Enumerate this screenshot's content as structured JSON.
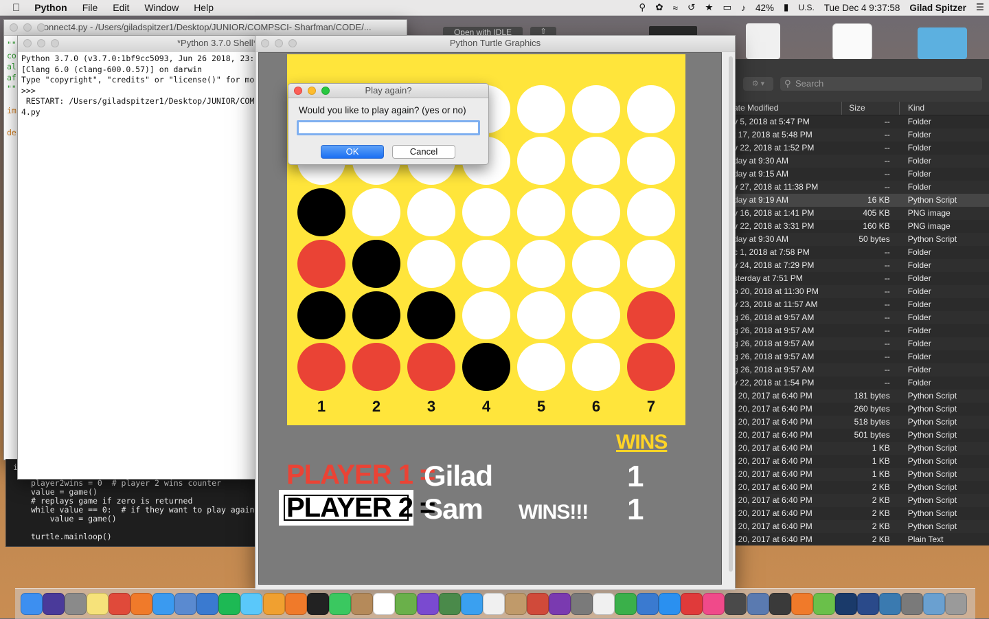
{
  "menubar": {
    "app": "Python",
    "items": [
      "File",
      "Edit",
      "Window",
      "Help"
    ],
    "battery": "42%",
    "input_source": "U.S.",
    "clock": "Tue Dec 4  9:37:58",
    "user": "Gilad  Spitzer"
  },
  "editor": {
    "title": "connect4.py - /Users/giladspitzer1/Desktop/JUNIOR/COMPSCI- Sharfman/CODE/...",
    "open_with_idle": "Open with IDLE",
    "lines": [
      {
        "text": "player2wins = 0  # player 2 wins counter",
        "color": "#e8e8e8"
      },
      {
        "text": "value = game()",
        "color": "#e8e8e8"
      },
      {
        "text": "# replays game if zero is returned",
        "color": "#e8e8e8"
      },
      {
        "text": "while value == 0:  # if they want to play again,",
        "color": "#e8e8e8"
      },
      {
        "text": "    value = game()",
        "color": "#e8e8e8"
      },
      {
        "text": "",
        "color": "#e8e8e8"
      },
      {
        "text": "turtle.mainloop()",
        "color": "#e8e8e8"
      }
    ]
  },
  "shell": {
    "title": "*Python 3.7.0 Shell*",
    "lines": [
      "Python 3.7.0 (v3.7.0:1bf9cc5093, Jun 26 2018, 23:",
      "[Clang 6.0 (clang-600.0.57)] on darwin",
      "Type \"copyright\", \"credits\" or \"license()\" for mo",
      ">>>",
      " RESTART: /Users/giladspitzer1/Desktop/JUNIOR/COM",
      "4.py"
    ]
  },
  "turtle_window": {
    "title": "Python Turtle Graphics"
  },
  "board": {
    "cells": [
      [
        "white",
        "white",
        "white",
        "white",
        "white",
        "white",
        "white"
      ],
      [
        "white",
        "white",
        "white",
        "white",
        "white",
        "white",
        "white"
      ],
      [
        "black",
        "white",
        "white",
        "white",
        "white",
        "white",
        "white"
      ],
      [
        "red",
        "black",
        "white",
        "white",
        "white",
        "white",
        "white"
      ],
      [
        "black",
        "black",
        "black",
        "white",
        "white",
        "white",
        "red"
      ],
      [
        "red",
        "red",
        "red",
        "black",
        "white",
        "white",
        "red"
      ]
    ],
    "column_numbers": [
      "1",
      "2",
      "3",
      "4",
      "5",
      "6",
      "7"
    ],
    "colors": {
      "board": "#ffe53b",
      "white": "#ffffff",
      "black": "#000000",
      "red": "#ea4335"
    }
  },
  "scoreboard": {
    "wins_header": "WINS",
    "player1_label": "PLAYER 1 =",
    "player1_name": "Gilad",
    "player1_wins": "1",
    "player2_label": "PLAYER 2 =",
    "player2_name": "Sam",
    "player2_wins": "1",
    "wins_banner": "WINS!!!",
    "colors": {
      "player1": "#ea4335",
      "wins_header": "#ffd426",
      "text": "#ffffff"
    }
  },
  "dialog": {
    "title": "Play again?",
    "prompt": "Would you like to play again? (yes or no)",
    "input_value": "",
    "ok_label": "OK",
    "cancel_label": "Cancel"
  },
  "finder": {
    "search_placeholder": "Search",
    "columns": {
      "date": "ate Modified",
      "size": "Size",
      "kind": "Kind"
    },
    "rows": [
      {
        "date": "v 5, 2018 at 5:47 PM",
        "size": "--",
        "kind": "Folder"
      },
      {
        "date": "t 17, 2018 at 5:48 PM",
        "size": "--",
        "kind": "Folder"
      },
      {
        "date": "v 22, 2018 at 1:52 PM",
        "size": "--",
        "kind": "Folder"
      },
      {
        "date": "day at 9:30 AM",
        "size": "--",
        "kind": "Folder"
      },
      {
        "date": "day at 9:15 AM",
        "size": "--",
        "kind": "Folder"
      },
      {
        "date": "v 27, 2018 at 11:38 PM",
        "size": "--",
        "kind": "Folder"
      },
      {
        "date": "day at 9:19 AM",
        "size": "16 KB",
        "kind": "Python Script",
        "selected": true
      },
      {
        "date": "v 16, 2018 at 1:41 PM",
        "size": "405 KB",
        "kind": "PNG image"
      },
      {
        "date": "v 22, 2018 at 3:31 PM",
        "size": "160 KB",
        "kind": "PNG image"
      },
      {
        "date": "day at 9:30 AM",
        "size": "50 bytes",
        "kind": "Python Script"
      },
      {
        "date": "c 1, 2018 at 7:58 PM",
        "size": "--",
        "kind": "Folder"
      },
      {
        "date": "v 24, 2018 at 7:29 PM",
        "size": "--",
        "kind": "Folder"
      },
      {
        "date": "sterday at 7:51 PM",
        "size": "--",
        "kind": "Folder"
      },
      {
        "date": "p 20, 2018 at 11:30 PM",
        "size": "--",
        "kind": "Folder"
      },
      {
        "date": "v 23, 2018 at 11:57 AM",
        "size": "--",
        "kind": "Folder"
      },
      {
        "date": "g 26, 2018 at 9:57 AM",
        "size": "--",
        "kind": "Folder"
      },
      {
        "date": "g 26, 2018 at 9:57 AM",
        "size": "--",
        "kind": "Folder"
      },
      {
        "date": "g 26, 2018 at 9:57 AM",
        "size": "--",
        "kind": "Folder"
      },
      {
        "date": "g 26, 2018 at 9:57 AM",
        "size": "--",
        "kind": "Folder"
      },
      {
        "date": "g 26, 2018 at 9:57 AM",
        "size": "--",
        "kind": "Folder"
      },
      {
        "date": "v 22, 2018 at 1:54 PM",
        "size": "--",
        "kind": "Folder"
      },
      {
        "date": "t 20, 2017 at 6:40 PM",
        "size": "181 bytes",
        "kind": "Python Script"
      },
      {
        "date": "t 20, 2017 at 6:40 PM",
        "size": "260 bytes",
        "kind": "Python Script"
      },
      {
        "date": "t 20, 2017 at 6:40 PM",
        "size": "518 bytes",
        "kind": "Python Script"
      },
      {
        "date": "t 20, 2017 at 6:40 PM",
        "size": "501 bytes",
        "kind": "Python Script"
      },
      {
        "date": "t 20, 2017 at 6:40 PM",
        "size": "1 KB",
        "kind": "Python Script"
      },
      {
        "date": "t 20, 2017 at 6:40 PM",
        "size": "1 KB",
        "kind": "Python Script"
      },
      {
        "date": "t 20, 2017 at 6:40 PM",
        "size": "1 KB",
        "kind": "Python Script"
      },
      {
        "date": "t 20, 2017 at 6:40 PM",
        "size": "2 KB",
        "kind": "Python Script"
      },
      {
        "date": "t 20, 2017 at 6:40 PM",
        "size": "2 KB",
        "kind": "Python Script"
      },
      {
        "date": "t 20, 2017 at 6:40 PM",
        "size": "2 KB",
        "kind": "Python Script"
      },
      {
        "date": "t 20, 2017 at 6:40 PM",
        "size": "2 KB",
        "kind": "Python Script"
      },
      {
        "date": "t 20, 2017 at 6:40 PM",
        "size": "2 KB",
        "kind": "Plain Text"
      }
    ]
  },
  "dock": {
    "icons": [
      {
        "name": "finder-icon",
        "color": "#3d8ff0"
      },
      {
        "name": "siri-icon",
        "color": "#4a3a9a"
      },
      {
        "name": "launchpad-icon",
        "color": "#8a8a8a"
      },
      {
        "name": "notes-icon",
        "color": "#f6e27a"
      },
      {
        "name": "chrome-icon",
        "color": "#e04a3a"
      },
      {
        "name": "firefox-icon",
        "color": "#f07a2a"
      },
      {
        "name": "safari-icon",
        "color": "#3a9af0"
      },
      {
        "name": "preview-icon",
        "color": "#5a8ad0"
      },
      {
        "name": "notifications-icon",
        "color": "#3a7ad0"
      },
      {
        "name": "spotify-icon",
        "color": "#1db954"
      },
      {
        "name": "messages-icon",
        "color": "#5ac8fa"
      },
      {
        "name": "photos-icon",
        "color": "#f0a030"
      },
      {
        "name": "flower-app-icon",
        "color": "#f07a2a"
      },
      {
        "name": "pycharm-icon",
        "color": "#222222"
      },
      {
        "name": "facetime-icon",
        "color": "#3ac860"
      },
      {
        "name": "contacts-icon",
        "color": "#b58a5a"
      },
      {
        "name": "calendar-icon",
        "color": "#ffffff"
      },
      {
        "name": "maps-icon",
        "color": "#6ab04a"
      },
      {
        "name": "imovie-icon",
        "color": "#7a4ad0"
      },
      {
        "name": "python-idle-icon",
        "color": "#4a8a4a"
      },
      {
        "name": "appstore-icon",
        "color": "#3aa0f0"
      },
      {
        "name": "reminders-icon",
        "color": "#f0f0f0"
      },
      {
        "name": "python-launcher-icon",
        "color": "#c09a6a"
      },
      {
        "name": "sketchup-icon",
        "color": "#d04a3a"
      },
      {
        "name": "onenote-icon",
        "color": "#7a3ab0"
      },
      {
        "name": "system-preferences-icon",
        "color": "#7a7a7a"
      },
      {
        "name": "textedit-icon",
        "color": "#f0f0f0"
      },
      {
        "name": "numbers-icon",
        "color": "#3ab04a"
      },
      {
        "name": "keynote-icon",
        "color": "#3a7ad0"
      },
      {
        "name": "app-store-2-icon",
        "color": "#2a90f0"
      },
      {
        "name": "no-entry-icon",
        "color": "#e03a3a"
      },
      {
        "name": "itunes-icon",
        "color": "#f04a8a"
      },
      {
        "name": "dvd-player-icon",
        "color": "#4a4a4a"
      },
      {
        "name": "folder-app-icon",
        "color": "#5a7ab0"
      },
      {
        "name": "call-of-duty-icon",
        "color": "#3a3a3a"
      },
      {
        "name": "flower-app-2-icon",
        "color": "#f07a2a"
      },
      {
        "name": "torrent-icon",
        "color": "#6ac04a"
      },
      {
        "name": "photoshop-icon",
        "color": "#1a3a6a"
      },
      {
        "name": "quicktime-icon",
        "color": "#2a4a8a"
      },
      {
        "name": "python-icon",
        "color": "#3a7ab0"
      },
      {
        "name": "rocket-icon",
        "color": "#7a7a7a"
      },
      {
        "name": "downloads-folder-icon",
        "color": "#6aa0d0"
      },
      {
        "name": "trash-icon",
        "color": "#9a9a9a"
      }
    ]
  }
}
